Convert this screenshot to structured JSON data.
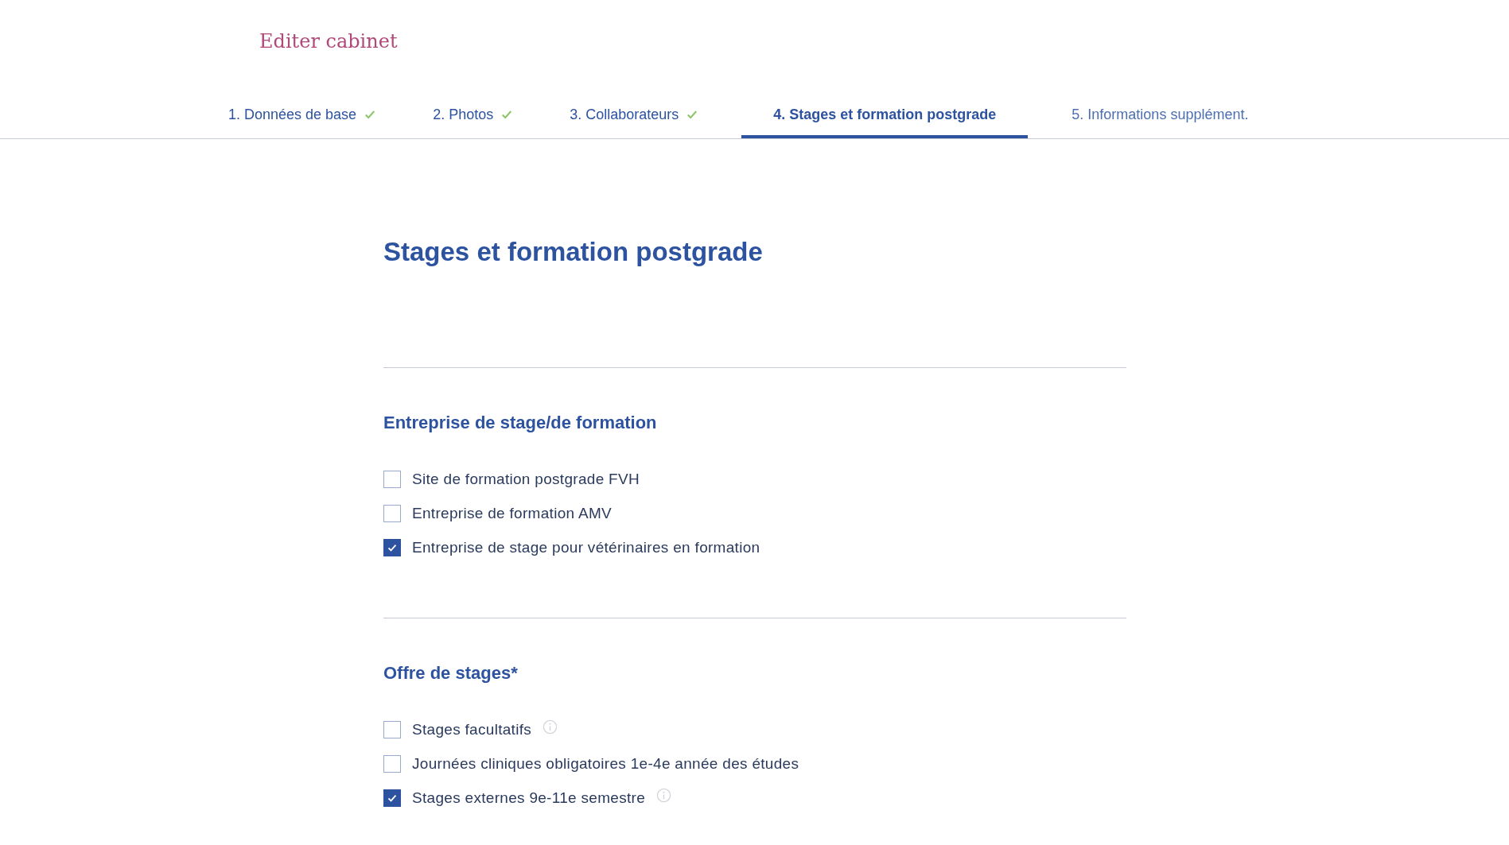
{
  "page_title": "Editer cabinet",
  "tabs": [
    {
      "label": "1. Données de base",
      "completed": true,
      "selected": false
    },
    {
      "label": "2. Photos",
      "completed": true,
      "selected": false
    },
    {
      "label": "3. Collaborateurs",
      "completed": true,
      "selected": false
    },
    {
      "label": "4. Stages et formation postgrade",
      "completed": false,
      "selected": true
    },
    {
      "label": "5. Informations supplément.",
      "completed": false,
      "selected": false
    }
  ],
  "heading": "Stages et formation postgrade",
  "sections": [
    {
      "title": "Entreprise de stage/de formation",
      "options": [
        {
          "label": "Site de formation postgrade FVH",
          "checked": false,
          "info": false
        },
        {
          "label": "Entreprise de formation AMV",
          "checked": false,
          "info": false
        },
        {
          "label": "Entreprise de stage pour vétérinaires en formation",
          "checked": true,
          "info": false
        }
      ]
    },
    {
      "title": "Offre de stages*",
      "options": [
        {
          "label": "Stages facultatifs",
          "checked": false,
          "info": true
        },
        {
          "label": "Journées cliniques obligatoires 1e-4e année des études",
          "checked": false,
          "info": false
        },
        {
          "label": "Stages externes 9e-11e semestre",
          "checked": true,
          "info": true
        }
      ]
    }
  ]
}
